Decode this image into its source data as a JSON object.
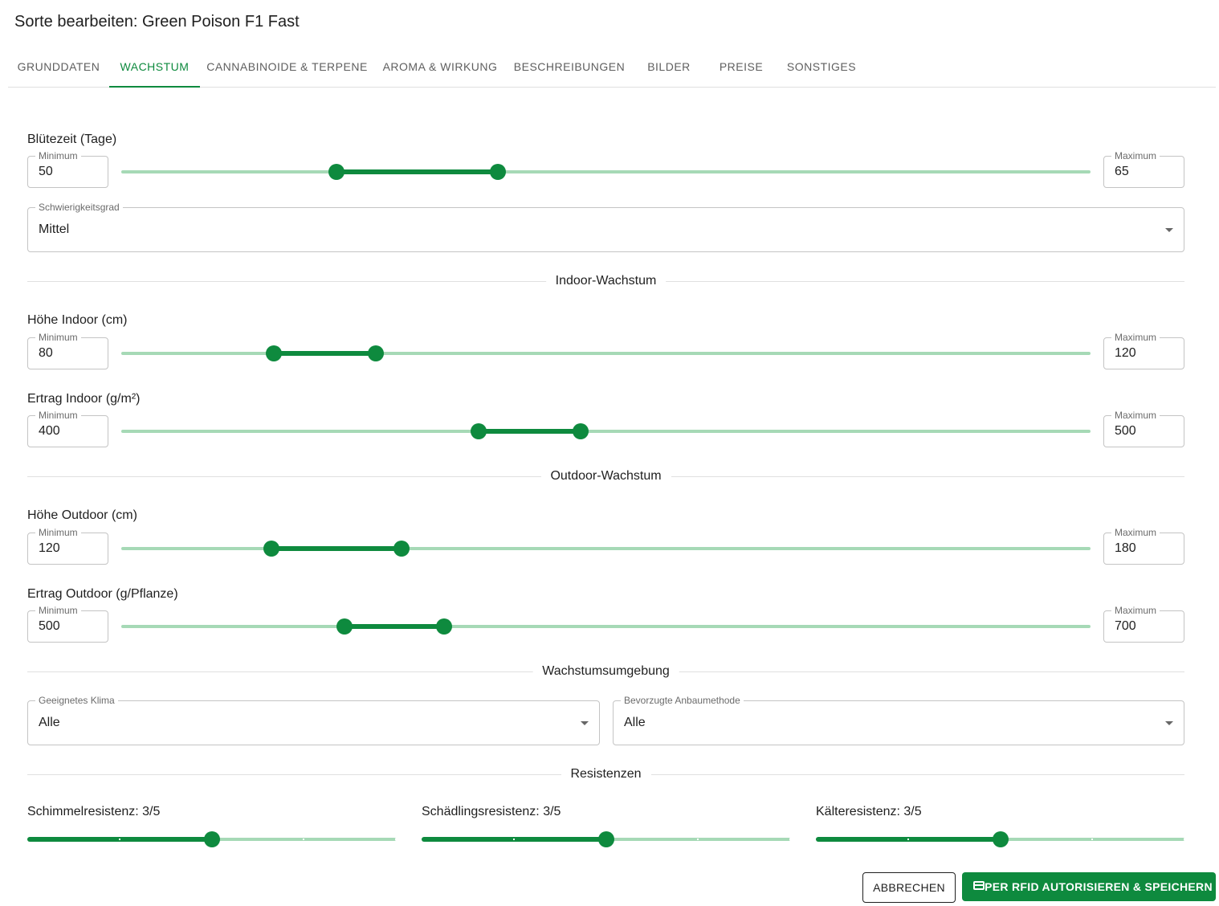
{
  "dialog": {
    "title": "Sorte bearbeiten: Green Poison F1 Fast"
  },
  "tabs": [
    {
      "label": "Grunddaten"
    },
    {
      "label": "Wachstum",
      "active": true
    },
    {
      "label": "Cannabinoide & Terpene"
    },
    {
      "label": "Aroma & Wirkung"
    },
    {
      "label": "Beschreibungen"
    },
    {
      "label": "Bilder"
    },
    {
      "label": "Preise"
    },
    {
      "label": "Sonstiges"
    }
  ],
  "labels": {
    "minimum": "Minimum",
    "maximum": "Maximum"
  },
  "ranges": {
    "bluetezeit": {
      "label": "Blütezeit (Tage)",
      "min": "50",
      "max": "65"
    },
    "hoehe_indoor": {
      "label": "Höhe Indoor (cm)",
      "min": "80",
      "max": "120"
    },
    "ertrag_indoor": {
      "label": "Ertrag Indoor (g/m²)",
      "min": "400",
      "max": "500"
    },
    "hoehe_outdoor": {
      "label": "Höhe Outdoor (cm)",
      "min": "120",
      "max": "180"
    },
    "ertrag_outdoor": {
      "label": "Ertrag Outdoor (g/Pflanze)",
      "min": "500",
      "max": "700"
    }
  },
  "selects": {
    "schwierigkeitsgrad": {
      "label": "Schwierigkeitsgrad",
      "value": "Mittel"
    },
    "klima": {
      "label": "Geeignetes Klima",
      "value": "Alle"
    },
    "anbaumethode": {
      "label": "Bevorzugte Anbaumethode",
      "value": "Alle"
    }
  },
  "sections": {
    "indoor": "Indoor-Wachstum",
    "outdoor": "Outdoor-Wachstum",
    "umgebung": "Wachstumsumgebung",
    "resistenzen": "Resistenzen"
  },
  "resistances": {
    "schimmel": {
      "label": "Schimmelresistenz: 3/5",
      "value": 3,
      "max": 5
    },
    "schaedling": {
      "label": "Schädlingsresistenz: 3/5",
      "value": 3,
      "max": 5
    },
    "kaelte": {
      "label": "Kälteresistenz: 3/5",
      "value": 3,
      "max": 5
    }
  },
  "actions": {
    "cancel": "Abbrechen",
    "save": "Per RFID autorisieren & speichern",
    "save_icon": "credit-card-icon"
  },
  "colors": {
    "accent": "#0e8a3e",
    "rail": "#a6d9b6"
  }
}
